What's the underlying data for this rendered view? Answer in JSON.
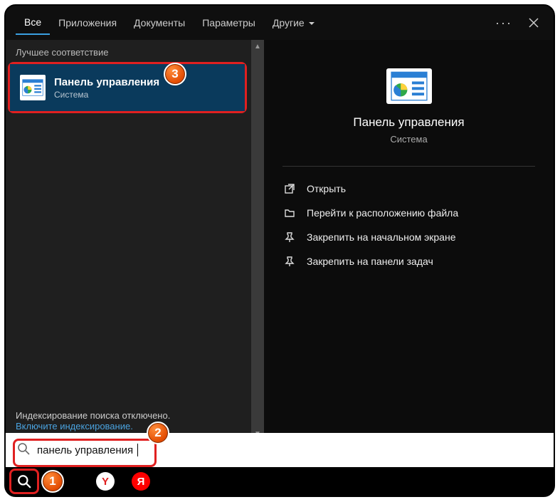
{
  "tabs": {
    "all": "Все",
    "apps": "Приложения",
    "documents": "Документы",
    "settings": "Параметры",
    "more": "Другие"
  },
  "left": {
    "section_header": "Лучшее соответствие",
    "result": {
      "title": "Панель управления",
      "subtitle": "Система"
    },
    "footer_status": "Индексирование поиска отключено.",
    "footer_link": "Включите индексирование."
  },
  "detail": {
    "title": "Панель управления",
    "subtitle": "Система",
    "actions": {
      "open": "Открыть",
      "open_location": "Перейти к расположению файла",
      "pin_start": "Закрепить на начальном экране",
      "pin_taskbar": "Закрепить на панели задач"
    }
  },
  "search": {
    "value": "панель управления"
  },
  "badges": {
    "b1": "1",
    "b2": "2",
    "b3": "3"
  }
}
